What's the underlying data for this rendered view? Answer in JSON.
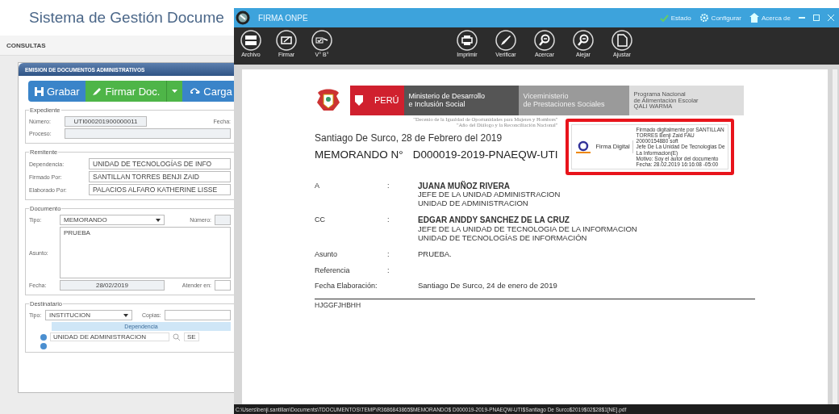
{
  "app": {
    "title": "Sistema de Gestión Docume",
    "menu": "CONSULTAS",
    "panel_title": "EMISION DE DOCUMENTOS ADMINISTRATIVOS",
    "buttons": [
      {
        "label": "Grabar",
        "kind": "save"
      },
      {
        "label": "Firmar Doc.",
        "kind": "sign"
      },
      {
        "kind": "dropdown"
      },
      {
        "label": "Carga",
        "kind": "upload"
      }
    ],
    "expediente": {
      "legend": "Expediente",
      "numero_label": "Número:",
      "numero": "UTI000201900000011",
      "fecha_label": "Fecha:",
      "proceso_label": "Proceso:"
    },
    "remitente": {
      "legend": "Remitente",
      "rows": [
        {
          "label": "Dependencia:",
          "value": "UNIDAD DE TECNOLOGÍAS DE INFO"
        },
        {
          "label": "Firmado Por:",
          "value": "SANTILLAN TORRES BENJI ZAID"
        },
        {
          "label": "Elaborado Por:",
          "value": "PALACIOS ALFARO KATHERINE LISSE"
        }
      ]
    },
    "documento": {
      "legend": "Documento",
      "tipo_label": "Tipo:",
      "tipo": "MEMORANDO",
      "numero_label": "Número:",
      "asunto_label": "Asunto:",
      "asunto": "PRUEBA",
      "fecha_label": "Fecha:",
      "fecha": "28/02/2019",
      "atender_label": "Atender en:"
    },
    "destinatario": {
      "legend": "Destinatario",
      "tipo_label": "Tipo:",
      "tipo": "INSTITUCION",
      "copias_label": "Copias:",
      "column": "Dependencia",
      "rows": [
        {
          "value": "UNIDAD DE ADMINISTRACION",
          "extra": "SE"
        }
      ]
    }
  },
  "window": {
    "title": "FIRMA ONPE",
    "status": [
      {
        "label": "Estado",
        "kind": "check"
      },
      {
        "label": "Configurar",
        "kind": "gear"
      },
      {
        "label": "Acerca de",
        "kind": "house"
      }
    ],
    "tools_left": [
      {
        "label": "Archivo",
        "kind": "file"
      },
      {
        "label": "Firmar",
        "kind": "sign"
      },
      {
        "label": "V° B°",
        "kind": "approve"
      }
    ],
    "tools_right": [
      {
        "label": "Imprimir",
        "kind": "print"
      },
      {
        "label": "Verificar",
        "kind": "verify"
      },
      {
        "label": "Acercar",
        "kind": "zoom_in"
      },
      {
        "label": "Alejar",
        "kind": "zoom_out"
      },
      {
        "label": "Ajustar",
        "kind": "fit"
      }
    ],
    "path": "C:\\Users\\benji.santillan\\Documents\\TDOCUMENTOS\\TEMP\\R3686843865$MEMORANDO$ D000019-2019-PNAEQW-UTI$Santiago De Surco$2019$02$28$1[NE].pdf"
  },
  "document": {
    "letterhead": {
      "country": "PERÚ",
      "ministry": [
        "Ministerio de Desarrollo",
        "e Inclusión Social"
      ],
      "vice": [
        "Viceministerio",
        "de Prestaciones Sociales"
      ],
      "program": [
        "Programa Nacional",
        "de Alimentación Escolar",
        "QALI WARMA"
      ]
    },
    "mottos": [
      "\"Decenio de la Igualdad de Oportunidades para Mujeres y Hombres\"",
      "\"Año del Diálogo y la Reconciliación Nacional\""
    ],
    "signature": {
      "brand": "Firma Digital",
      "lines": [
        "Firmado digitalmente por SANTILLAN",
        "TORRES Benji Zaid FAU",
        "20000154880 soft",
        "Jefe De La Unidad De Tecnologias De",
        "La Informacion(E)",
        "Motivo: Soy el autor del documento",
        "Fecha: 28.02.2019 16:16:08 -05:00"
      ]
    },
    "place_date": "Santiago De Surco, 28 de Febrero del 2019",
    "memo_label": "MEMORANDO N°",
    "memo_number": "D000019-2019-PNAEQW-UTI",
    "fields": [
      {
        "label": "A",
        "sep": ":",
        "lines": [
          "JUANA MUÑOZ RIVERA",
          "JEFE DE LA UNIDAD ADMINISTRACION",
          "UNIDAD DE ADMINISTRACION"
        ]
      },
      {
        "label": "CC",
        "sep": ":",
        "lines": [
          "EDGAR ANDDY SANCHEZ DE LA CRUZ",
          "JEFE DE LA UNIDAD DE TECNOLOGIA DE LA INFORMACION",
          "UNIDAD DE TECNOLOGÍAS DE INFORMACIÓN"
        ]
      },
      {
        "label": "Asunto",
        "sep": ":",
        "lines": [
          "PRUEBA."
        ]
      },
      {
        "label": "Referencia",
        "sep": ":"
      },
      {
        "label": "Fecha Elaboración:",
        "lines": [
          "Santiago De Surco, 24 de enero de 2019"
        ]
      }
    ],
    "footer": "HJGGFJHBHH"
  }
}
